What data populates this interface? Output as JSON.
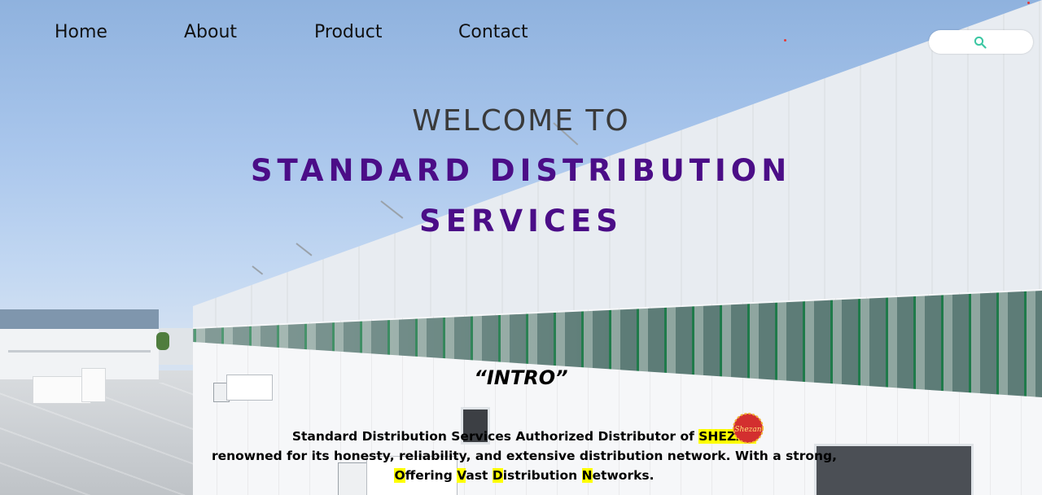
{
  "nav": {
    "items": [
      {
        "label": "Home"
      },
      {
        "label": "About"
      },
      {
        "label": "Product"
      },
      {
        "label": "Contact"
      }
    ]
  },
  "search": {
    "placeholder": "",
    "icon": "search-icon",
    "icon_color": "#3cc7a3"
  },
  "hero": {
    "welcome": "WELCOME TO",
    "title_line1": "STANDARD DISTRIBUTION",
    "title_line2": "SERVICES",
    "title_color": "#4b0d87"
  },
  "intro": {
    "heading": "“INTRO”",
    "line1_prefix": "Standard Distribution Services Authorized Distributor of ",
    "line1_brand": "SHEZAN",
    "line2": "renowned for its honesty, reliability, and extensive distribution network. With a strong,",
    "line3_parts": [
      {
        "text": "O",
        "highlight": true
      },
      {
        "text": "ffering ",
        "highlight": false
      },
      {
        "text": "V",
        "highlight": true
      },
      {
        "text": "ast ",
        "highlight": false
      },
      {
        "text": "D",
        "highlight": true
      },
      {
        "text": "istribution ",
        "highlight": false
      },
      {
        "text": "N",
        "highlight": true
      },
      {
        "text": "etworks.",
        "highlight": false
      }
    ],
    "highlight_color": "#ffff00"
  },
  "logo": {
    "text": "Shezan",
    "color": "#d32f2f"
  }
}
